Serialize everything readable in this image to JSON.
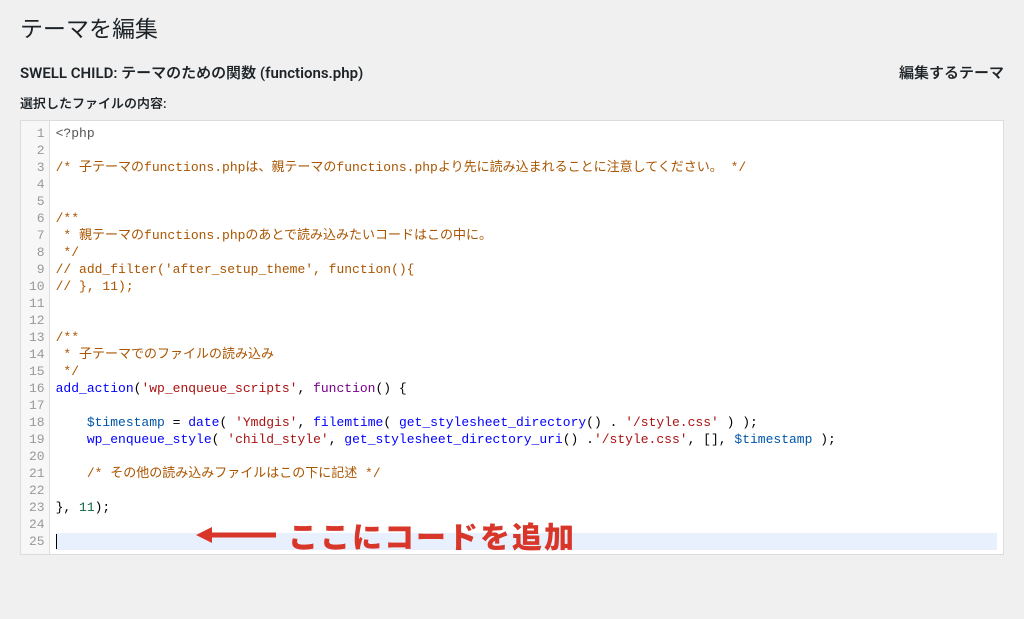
{
  "page_title": "テーマを編集",
  "file_heading_prefix": "SWELL CHILD: ",
  "file_heading_main": "テーマのための関数 ",
  "file_heading_file": "(functions.php)",
  "right_label": "編集するテーマ",
  "sub_label": "選択したファイルの内容:",
  "annotation_text": "ここにコードを追加",
  "colors": {
    "accent_red": "#d9362a"
  },
  "lines": [
    {
      "n": 1,
      "tokens": [
        [
          "meta",
          "<?php"
        ]
      ]
    },
    {
      "n": 2,
      "tokens": []
    },
    {
      "n": 3,
      "tokens": [
        [
          "comment",
          "/* 子テーマのfunctions.phpは、親テーマのfunctions.phpより先に読み込まれることに注意してください。 */"
        ]
      ]
    },
    {
      "n": 4,
      "tokens": []
    },
    {
      "n": 5,
      "tokens": []
    },
    {
      "n": 6,
      "tokens": [
        [
          "comment",
          "/**"
        ]
      ]
    },
    {
      "n": 7,
      "tokens": [
        [
          "comment",
          " * 親テーマのfunctions.phpのあとで読み込みたいコードはこの中に。"
        ]
      ]
    },
    {
      "n": 8,
      "tokens": [
        [
          "comment",
          " */"
        ]
      ]
    },
    {
      "n": 9,
      "tokens": [
        [
          "comment",
          "// add_filter('after_setup_theme', function(){"
        ]
      ]
    },
    {
      "n": 10,
      "tokens": [
        [
          "comment",
          "// }, 11);"
        ]
      ]
    },
    {
      "n": 11,
      "tokens": []
    },
    {
      "n": 12,
      "tokens": []
    },
    {
      "n": 13,
      "tokens": [
        [
          "comment",
          "/**"
        ]
      ]
    },
    {
      "n": 14,
      "tokens": [
        [
          "comment",
          " * 子テーマでのファイルの読み込み"
        ]
      ]
    },
    {
      "n": 15,
      "tokens": [
        [
          "comment",
          " */"
        ]
      ]
    },
    {
      "n": 16,
      "tokens": [
        [
          "def",
          "add_action"
        ],
        [
          "paren",
          "("
        ],
        [
          "string",
          "'wp_enqueue_scripts'"
        ],
        [
          "paren",
          ", "
        ],
        [
          "keyword",
          "function"
        ],
        [
          "paren",
          "() {"
        ]
      ]
    },
    {
      "n": 17,
      "tokens": []
    },
    {
      "n": 18,
      "tokens": [
        [
          "plain",
          "    "
        ],
        [
          "variable",
          "$timestamp"
        ],
        [
          "plain",
          " = "
        ],
        [
          "def",
          "date"
        ],
        [
          "paren",
          "( "
        ],
        [
          "string",
          "'Ymdgis'"
        ],
        [
          "paren",
          ", "
        ],
        [
          "def",
          "filemtime"
        ],
        [
          "paren",
          "( "
        ],
        [
          "def",
          "get_stylesheet_directory"
        ],
        [
          "paren",
          "() . "
        ],
        [
          "string",
          "'/style.css'"
        ],
        [
          "paren",
          " ) );"
        ]
      ]
    },
    {
      "n": 19,
      "tokens": [
        [
          "plain",
          "    "
        ],
        [
          "def",
          "wp_enqueue_style"
        ],
        [
          "paren",
          "( "
        ],
        [
          "string",
          "'child_style'"
        ],
        [
          "paren",
          ", "
        ],
        [
          "def",
          "get_stylesheet_directory_uri"
        ],
        [
          "paren",
          "() ."
        ],
        [
          "string",
          "'/style.css'"
        ],
        [
          "paren",
          ", [], "
        ],
        [
          "variable",
          "$timestamp"
        ],
        [
          "paren",
          " );"
        ]
      ]
    },
    {
      "n": 20,
      "tokens": []
    },
    {
      "n": 21,
      "tokens": [
        [
          "plain",
          "    "
        ],
        [
          "comment",
          "/* その他の読み込みファイルはこの下に記述 */"
        ]
      ]
    },
    {
      "n": 22,
      "tokens": []
    },
    {
      "n": 23,
      "tokens": [
        [
          "paren",
          "}, "
        ],
        [
          "number",
          "11"
        ],
        [
          "paren",
          ");"
        ]
      ]
    },
    {
      "n": 24,
      "tokens": []
    },
    {
      "n": 25,
      "tokens": [],
      "active": true,
      "cursor": true
    }
  ]
}
